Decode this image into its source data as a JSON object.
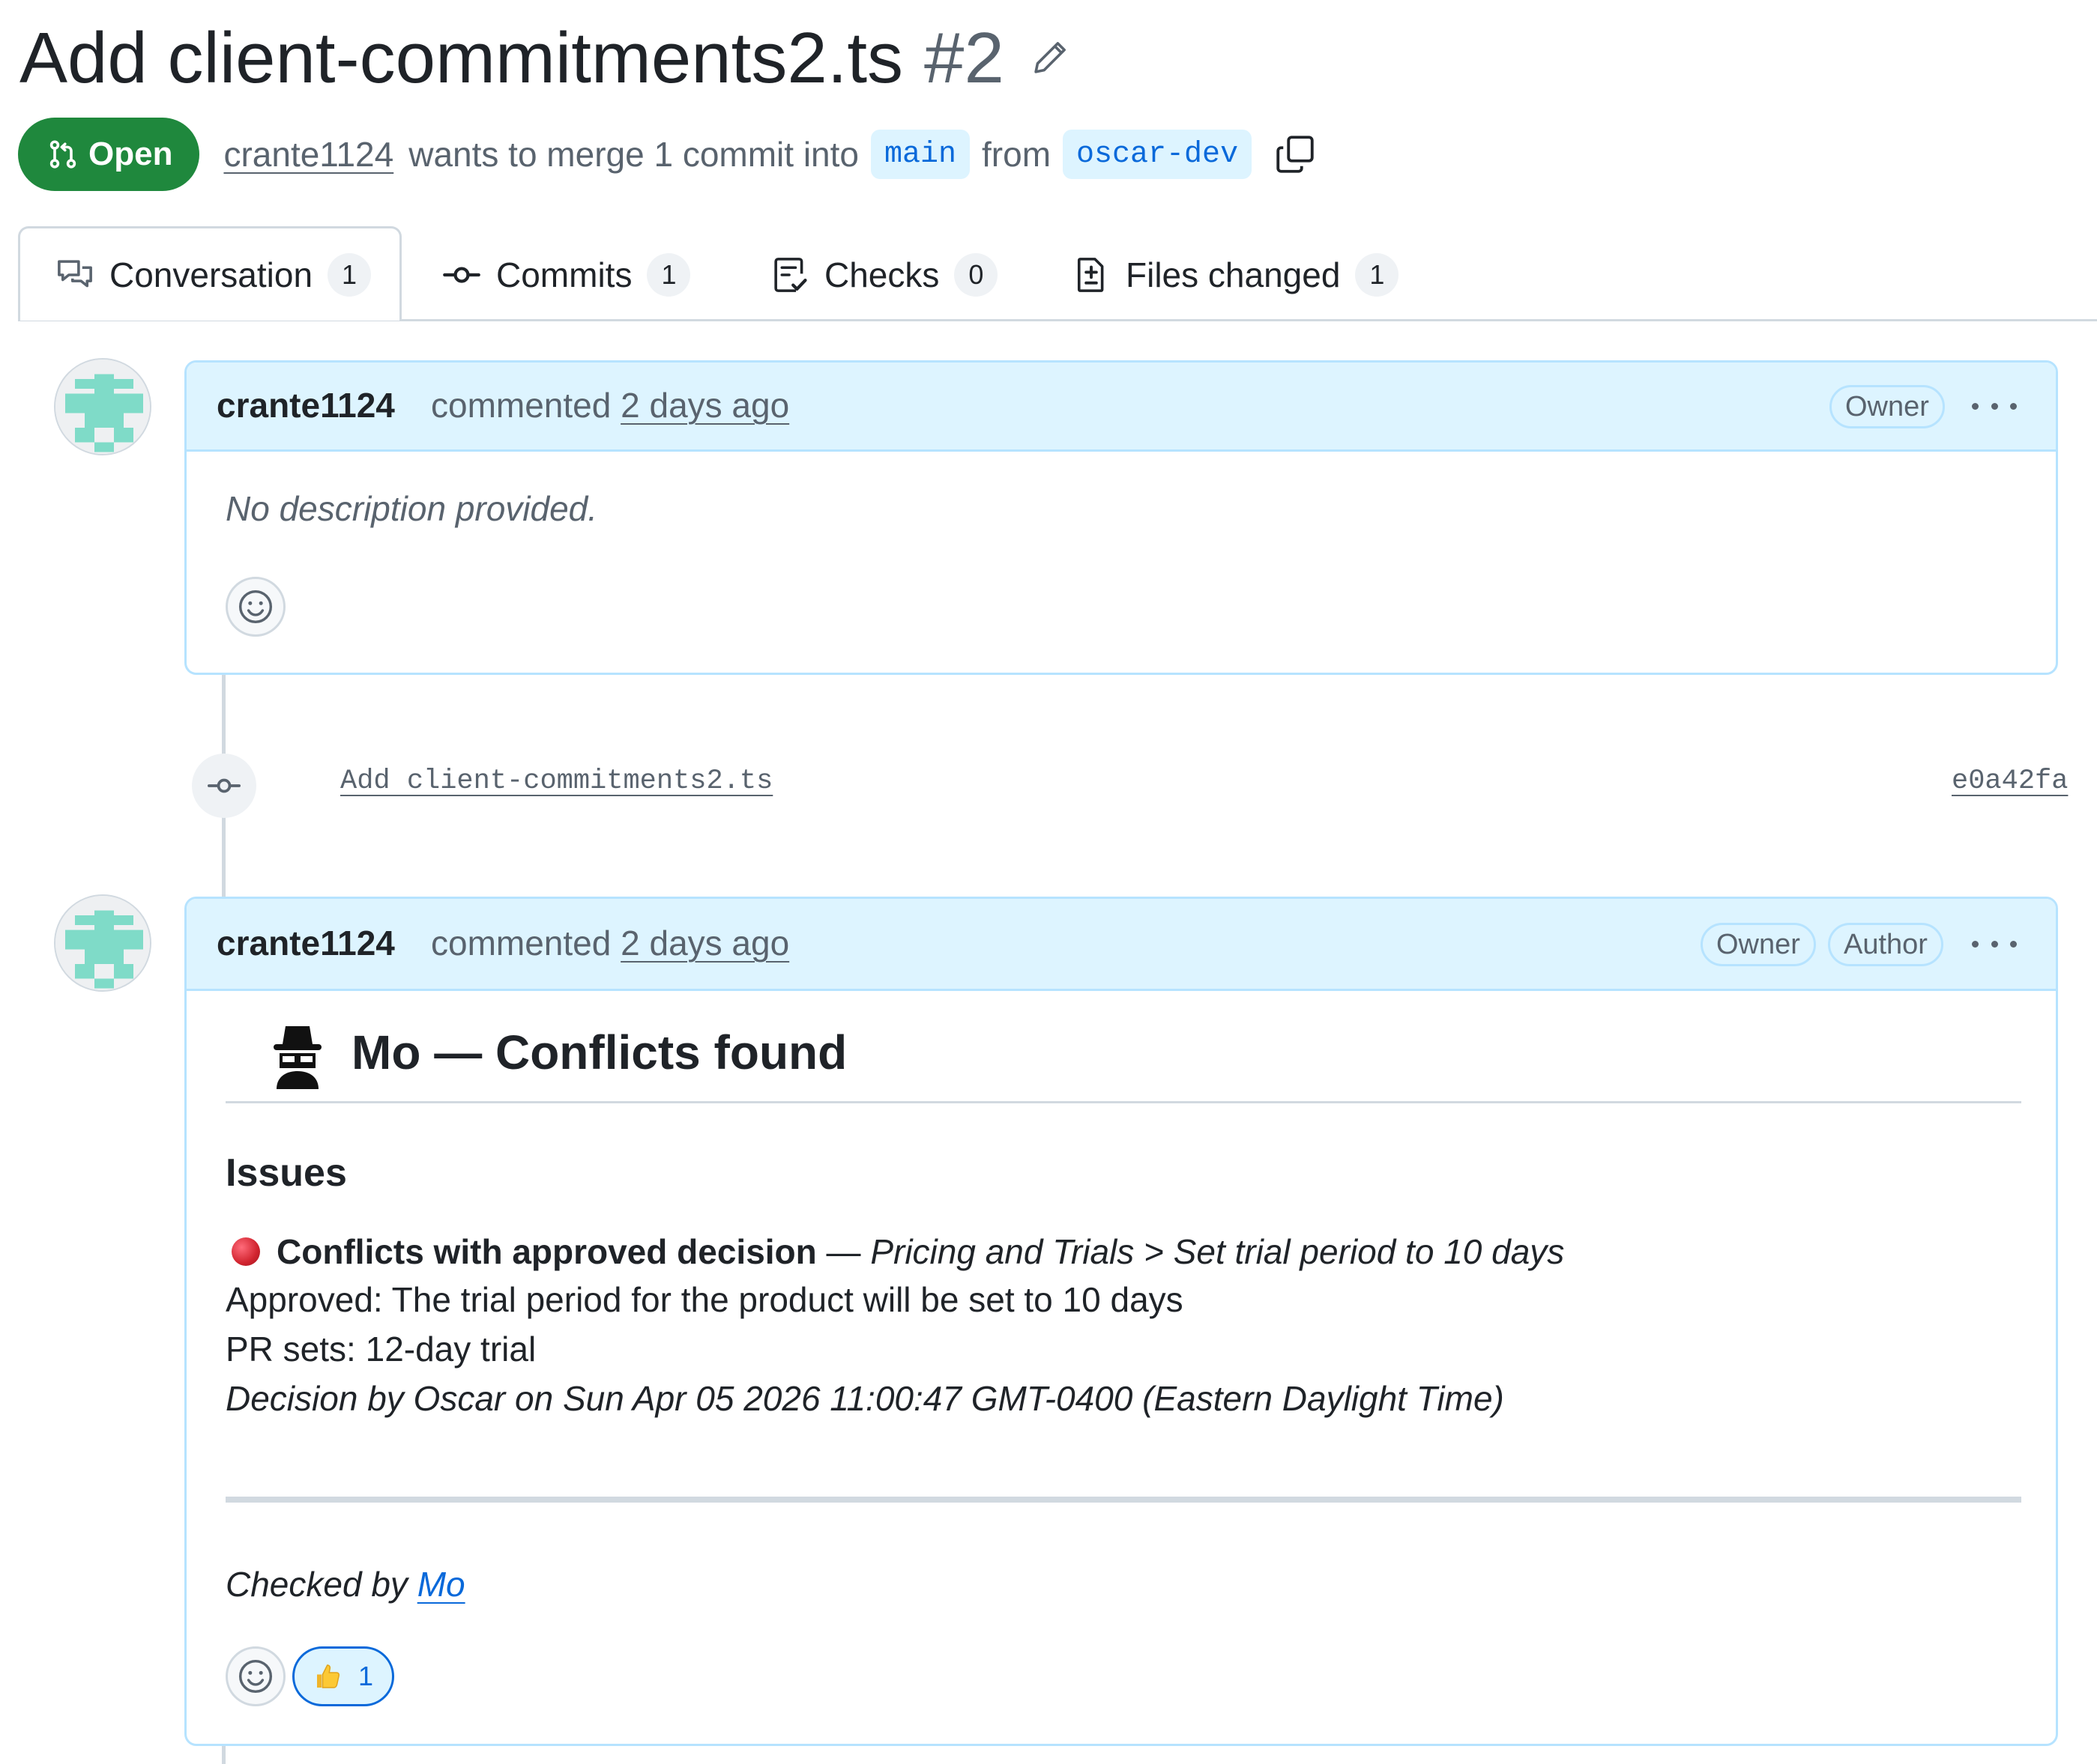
{
  "pr": {
    "title": "Add client-commitments2.ts",
    "number": "#2",
    "state": "Open",
    "author": "crante1124",
    "merge_text": "wants to merge 1 commit into",
    "base_branch": "main",
    "from_text": "from",
    "head_branch": "oscar-dev"
  },
  "tabs": [
    {
      "label": "Conversation",
      "count": "1",
      "icon": "comment-discussion-icon"
    },
    {
      "label": "Commits",
      "count": "1",
      "icon": "git-commit-icon"
    },
    {
      "label": "Checks",
      "count": "0",
      "icon": "checklist-icon"
    },
    {
      "label": "Files changed",
      "count": "1",
      "icon": "file-diff-icon"
    }
  ],
  "comment1": {
    "author": "crante1124",
    "action": "commented",
    "time": "2 days ago",
    "badges": [
      "Owner"
    ],
    "body": "No description provided."
  },
  "commit": {
    "message": "Add client-commitments2.ts",
    "sha": "e0a42fa"
  },
  "comment2": {
    "author": "crante1124",
    "action": "commented",
    "time": "2 days ago",
    "badges": [
      "Owner",
      "Author"
    ],
    "heading": "Mo — Conflicts found",
    "issues_heading": "Issues",
    "issue_title": "Conflicts with approved decision",
    "issue_dash": " — ",
    "issue_path": "Pricing and Trials > Set trial period to 10 days",
    "approved_line": "Approved: The trial period for the product will be set to 10 days",
    "pr_sets_line": "PR sets: 12-day trial",
    "decision_line": "Decision by Oscar on Sun Apr 05 2026 11:00:47 GMT-0400 (Eastern Daylight Time)",
    "checked_by_prefix": "Checked by ",
    "checked_by_link": "Mo",
    "reactions": [
      {
        "emoji": "thumbs-up",
        "glyph": "👍",
        "count": "1"
      }
    ]
  },
  "colors": {
    "open_green": "#1f883d",
    "link_blue": "#0969da",
    "header_blue": "#ddf4ff",
    "issue_red": "#d1242f"
  }
}
